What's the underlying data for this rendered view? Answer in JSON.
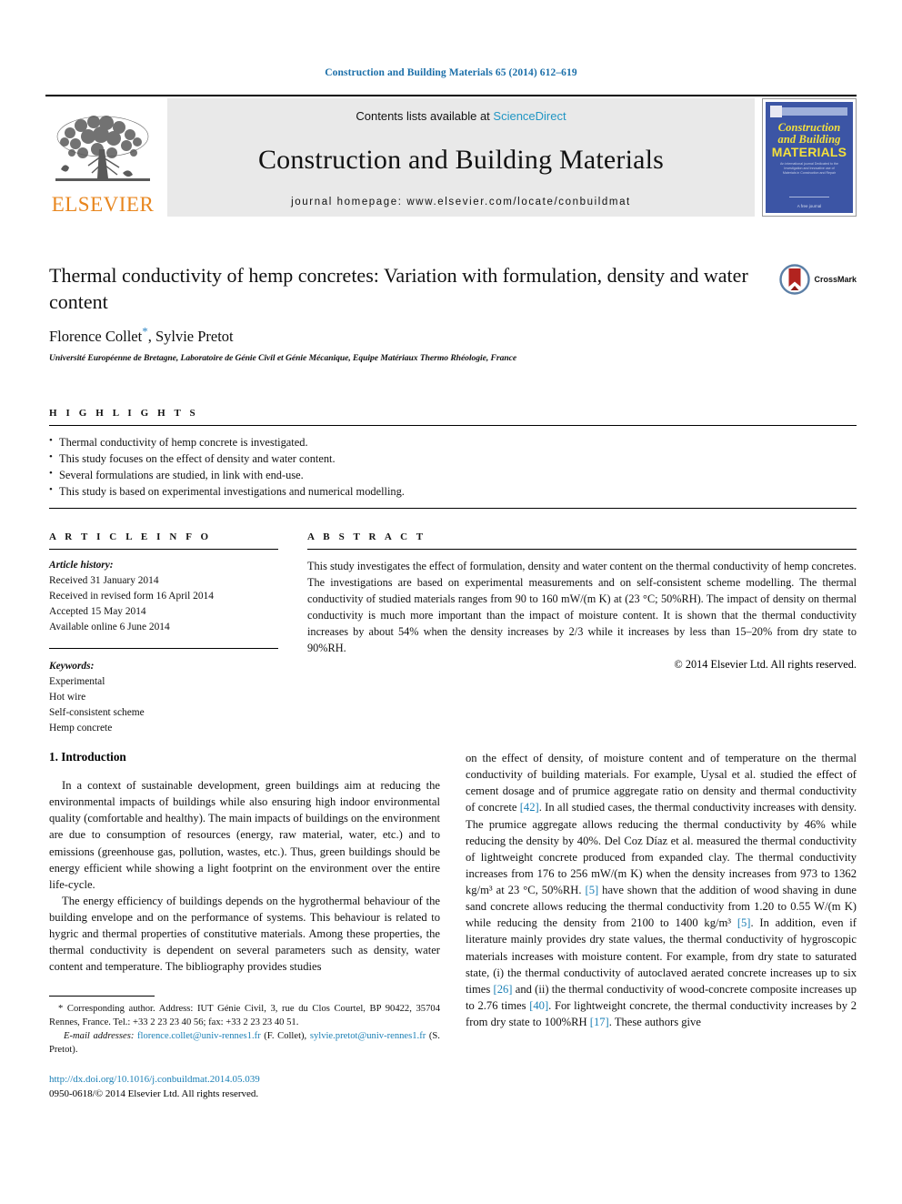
{
  "running_head": "Construction and Building Materials 65 (2014) 612–619",
  "masthead": {
    "publisher_logo_label": "ELSEVIER",
    "contents_prefix": "Contents lists available at ",
    "contents_link": "ScienceDirect",
    "journal_name": "Construction and Building Materials",
    "homepage_line": "journal homepage: www.elsevier.com/locate/conbuildmat",
    "cover": {
      "line1": "Construction",
      "line2": "and Building",
      "line3": "MATERIALS",
      "blurb": "An international journal Dedicated to the Investigation and Innovative use of Materials in Construction and Repair",
      "footer": "A free journal"
    }
  },
  "article": {
    "title": "Thermal conductivity of hemp concretes: Variation with formulation, density and water content",
    "authors": "Florence Collet",
    "corresponding_marker": "*",
    "authors_rest": ", Sylvie Pretot",
    "affiliation": "Université Européenne de Bretagne, Laboratoire de Génie Civil et Génie Mécanique, Equipe Matériaux Thermo Rhéologie, France",
    "crossmark_label": "CrossMark"
  },
  "highlights": {
    "label": "H I G H L I G H T S",
    "items": [
      "Thermal conductivity of hemp concrete is investigated.",
      "This study focuses on the effect of density and water content.",
      "Several formulations are studied, in link with end-use.",
      "This study is based on experimental investigations and numerical modelling."
    ]
  },
  "article_info": {
    "label": "A R T I C L E   I N F O",
    "history_label": "Article history:",
    "history": [
      "Received 31 January 2014",
      "Received in revised form 16 April 2014",
      "Accepted 15 May 2014",
      "Available online 6 June 2014"
    ],
    "keywords_label": "Keywords:",
    "keywords": [
      "Experimental",
      "Hot wire",
      "Self-consistent scheme",
      "Hemp concrete"
    ]
  },
  "abstract": {
    "label": "A B S T R A C T",
    "text": "This study investigates the effect of formulation, density and water content on the thermal conductivity of hemp concretes. The investigations are based on experimental measurements and on self-consistent scheme modelling. The thermal conductivity of studied materials ranges from 90 to 160 mW/(m K) at (23 °C; 50%RH). The impact of density on thermal conductivity is much more important than the impact of moisture content. It is shown that the thermal conductivity increases by about 54% when the density increases by 2/3 while it increases by less than 15–20% from dry state to 90%RH.",
    "copyright": "© 2014 Elsevier Ltd. All rights reserved."
  },
  "body": {
    "section_heading": "1. Introduction",
    "left_paragraphs": [
      "In a context of sustainable development, green buildings aim at reducing the environmental impacts of buildings while also ensuring high indoor environmental quality (comfortable and healthy). The main impacts of buildings on the environment are due to consumption of resources (energy, raw material, water, etc.) and to emissions (greenhouse gas, pollution, wastes, etc.). Thus, green buildings should be energy efficient while showing a light footprint on the environment over the entire life-cycle.",
      "The energy efficiency of buildings depends on the hygrothermal behaviour of the building envelope and on the performance of systems. This behaviour is related to hygric and thermal properties of constitutive materials. Among these properties, the thermal conductivity is dependent on several parameters such as density, water content and temperature. The bibliography provides studies"
    ],
    "right_paragraph_parts": [
      "on the effect of density, of moisture content and of temperature on the thermal conductivity of building materials. For example, Uysal et al. studied the effect of cement dosage and of prumice aggregate ratio on density and thermal conductivity of concrete ",
      "[42]",
      ". In all studied cases, the thermal conductivity increases with density. The prumice aggregate allows reducing the thermal conductivity by 46% while reducing the density by 40%. Del Coz Díaz et al. measured the thermal conductivity of lightweight concrete produced from expanded clay. The thermal conductivity increases from 176 to 256 mW/(m K) when the density increases from 973 to 1362 kg/m³ at 23 °C, 50%RH. ",
      "[5]",
      " have shown that the addition of wood shaving in dune sand concrete allows reducing the thermal conductivity from 1.20 to 0.55 W/(m K) while reducing the density from 2100 to 1400 kg/m³ ",
      "[5]",
      ". In addition, even if literature mainly provides dry state values, the thermal conductivity of hygroscopic materials increases with moisture content. For example, from dry state to saturated state, (i) the thermal conductivity of autoclaved aerated concrete increases up to six times ",
      "[26]",
      " and (ii) the thermal conductivity of wood-concrete composite increases up to 2.76 times ",
      "[40]",
      ". For lightweight concrete, the thermal conductivity increases by 2 from dry state to 100%RH ",
      "[17]",
      ". These authors give"
    ]
  },
  "footnote": {
    "corresponding": "* Corresponding author. Address: IUT Génie Civil, 3, rue du Clos Courtel, BP 90422, 35704 Rennes, France. Tel.: +33 2 23 23 40 56; fax: +33 2 23 23 40 51.",
    "email_label": "E-mail addresses:",
    "email1": "florence.collet@univ-rennes1.fr",
    "email1_owner": "(F. Collet),",
    "email2": "sylvie.pretot@univ-rennes1.fr",
    "email2_owner": "(S. Pretot).",
    "doi": "http://dx.doi.org/10.1016/j.conbuildmat.2014.05.039",
    "issn_line": "0950-0618/© 2014 Elsevier Ltd. All rights reserved."
  },
  "colors": {
    "link": "#1a7fb5",
    "sciencedirect": "#2196c4",
    "elsevier_orange": "#E8861E",
    "cover_blue": "#3c55a5",
    "cover_yellow": "#f4e03c"
  }
}
